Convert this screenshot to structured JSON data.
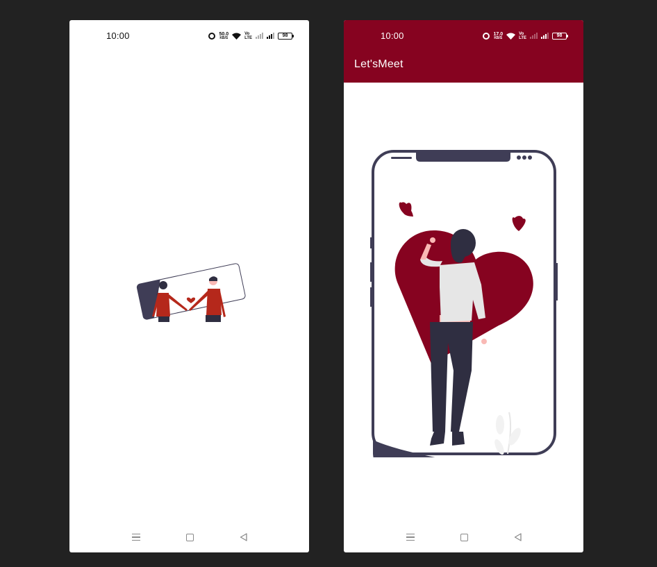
{
  "splash_screen": {
    "status_bar": {
      "time": "10:00",
      "network_speed": "50.0",
      "network_speed_unit": "KB/S",
      "volte_top": "Vo",
      "volte_bottom": "LTE",
      "battery": "98"
    },
    "illustration": "couple-holding-hands-illustration",
    "nav_icons": [
      "menu-icon",
      "home-icon",
      "back-icon"
    ]
  },
  "main_screen": {
    "status_bar": {
      "time": "10:00",
      "network_speed": "17.0",
      "network_speed_unit": "KB/S",
      "volte_top": "Vo",
      "volte_bottom": "LTE",
      "battery": "98"
    },
    "app_bar": {
      "title": "Let'sMeet",
      "background": "#860320"
    },
    "illustration": "woman-with-heart-in-phone-illustration",
    "nav_icons": [
      "menu-icon",
      "home-icon",
      "back-icon"
    ]
  },
  "colors": {
    "accent": "#860320",
    "background": "#222222",
    "illustration_dark": "#3f3d56",
    "shirt_red": "#b5281b"
  }
}
